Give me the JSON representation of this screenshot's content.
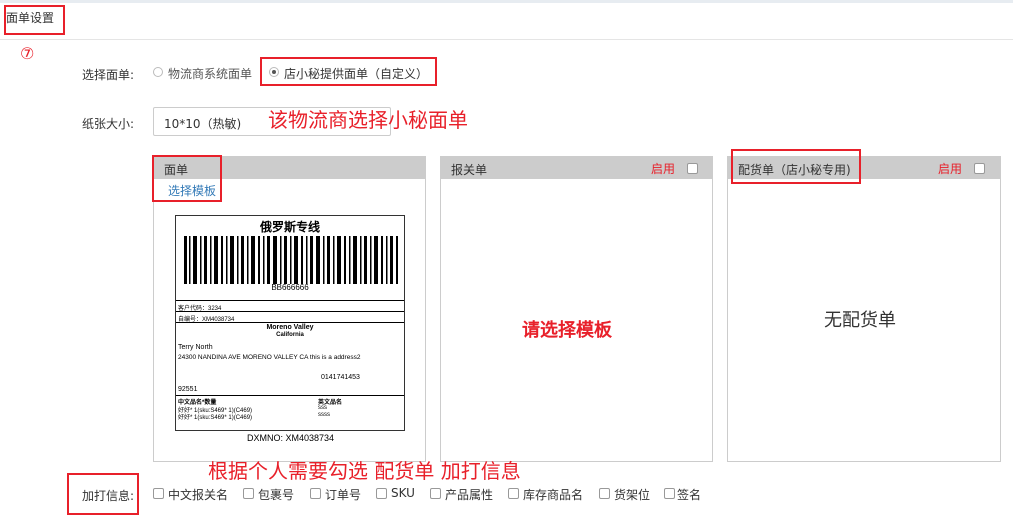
{
  "tab": {
    "label": "面单设置"
  },
  "annotations": {
    "step_marker": "⑦",
    "choose_small_secret": "该物流商选择小秘面单",
    "please_choose": "请选择模板",
    "check_hint": "根据个人需要勾选 配货单 加打信息"
  },
  "form": {
    "waybill_label": "选择面单:",
    "radio_options": [
      {
        "label": "物流商系统面单",
        "selected": false
      },
      {
        "label": "店小秘提供面单（自定义）",
        "selected": true
      }
    ],
    "paper_label": "纸张大小:",
    "paper_value": "10*10（热敏)"
  },
  "panels": {
    "waybill": {
      "title": "面单",
      "choose_link": "选择模板"
    },
    "customs": {
      "title": "报关单",
      "enable": "启用"
    },
    "picking": {
      "title": "配货单（店小秘专用)",
      "enable": "启用",
      "empty": "无配货单"
    }
  },
  "label_preview": {
    "title": "俄罗斯专线",
    "barcode_number": "BB666666",
    "customer_code": "客户代码：3234",
    "order_no": "自编号：XM4038734",
    "city": "Moreno Valley",
    "state": "California",
    "name": "Terry North",
    "address": "24300 NANDINA AVE MORENO VALLEY CA this is a address2",
    "phone": "0141741453",
    "zip": "92551",
    "col_cn": "中文品名*数量",
    "col_en": "英文品名",
    "item1_cn": "好好* 1(sku:S469* 1)(C469)",
    "item1_en": "sss",
    "item2_cn": "好好* 1(sku:S469* 1)(C469)",
    "item2_en": "ssss",
    "dxmno": "DXMNO: XM4038734"
  },
  "print_info": {
    "label": "加打信息:",
    "options": [
      "中文报关名",
      "包裹号",
      "订单号",
      "SKU",
      "产品属性",
      "库存商品名",
      "货架位",
      "签名"
    ]
  },
  "colors": {
    "accent": "#e8202a",
    "link": "#337ab7",
    "panel_header": "#cccccc"
  }
}
